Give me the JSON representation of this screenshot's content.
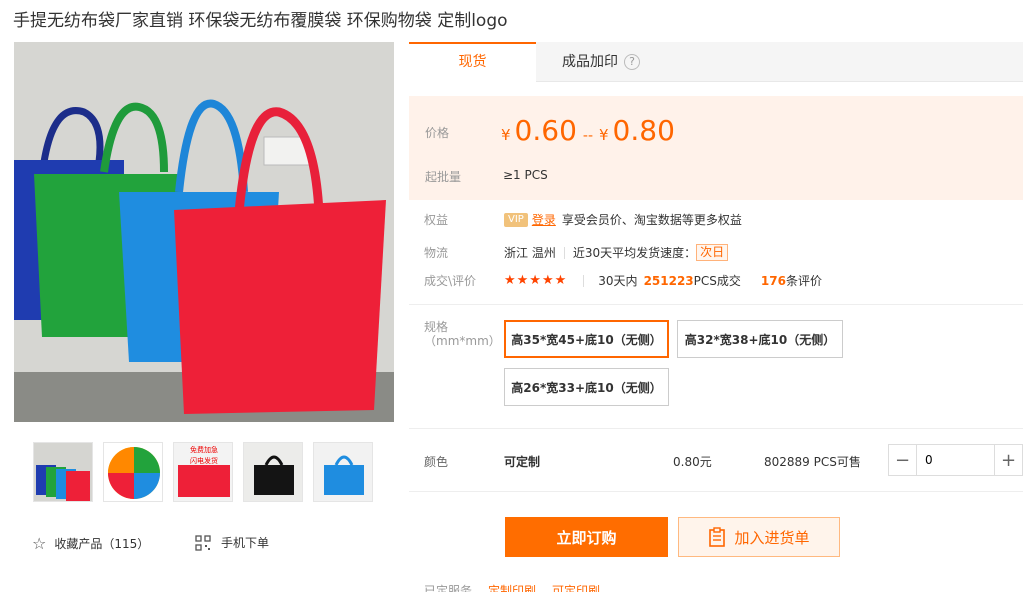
{
  "product": {
    "title": "手提无纺布袋厂家直销 环保袋无纺布覆膜袋 环保购物袋 定制logo"
  },
  "gallery": {
    "favorite_label": "收藏产品（115）",
    "mobile_label": "手机下单"
  },
  "tabs": [
    {
      "label": "现货"
    },
    {
      "label": "成品加印"
    }
  ],
  "price": {
    "label": "价格",
    "currency": "¥",
    "low": "0.60",
    "separator": "--",
    "high": "0.80"
  },
  "moq": {
    "label": "起批量",
    "value": "≥1  PCS"
  },
  "benefits": {
    "label": "权益",
    "vip": "VIP",
    "login": "登录",
    "text": "享受会员价、淘宝数据等更多权益"
  },
  "logistics": {
    "label": "物流",
    "origin": "浙江  温州",
    "speed_text": "近30天平均发货速度：",
    "speed_value": "次日"
  },
  "reviews": {
    "label": "成交\\评价",
    "stars": "★★★★★",
    "sold_prefix": "30天内",
    "sold_count": "251223",
    "sold_suffix": "PCS成交",
    "review_count": "176",
    "review_suffix": "条评价"
  },
  "specs": {
    "label": "规格",
    "unit": "（mm*mm）",
    "options": [
      {
        "label": "高35*宽45+底10（无侧）"
      },
      {
        "label": "高32*宽38+底10（无侧）"
      },
      {
        "label": "高26*宽33+底10（无侧）"
      }
    ]
  },
  "color": {
    "label": "颜色",
    "value": "可定制",
    "price": "0.80元",
    "stock": "802889 PCS可售",
    "quantity": "0",
    "minus": "−",
    "plus": "+"
  },
  "actions": {
    "buy": "立即订购",
    "cart": "加入进货单"
  },
  "cutoff": {
    "label": "已定服务",
    "item1": "定制印刷",
    "item2": "可定印刷"
  },
  "thumb_text": {
    "t3a": "免费加急",
    "t3b": "闪电发货"
  },
  "colors": {
    "accent": "#ff6600",
    "price_bg": "#fff2ea"
  }
}
